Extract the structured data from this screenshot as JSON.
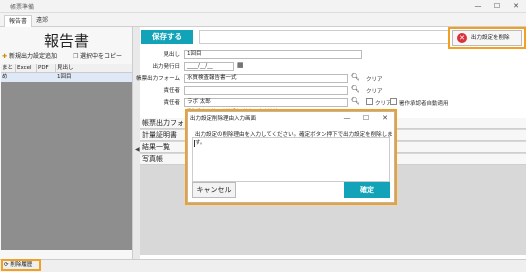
{
  "window": {
    "title": "帳票準備"
  },
  "tabs": [
    {
      "label": "報告書",
      "active": true
    },
    {
      "label": "遠郊",
      "active": false
    }
  ],
  "left": {
    "title": "報告書",
    "add_label": "新規出力設定追加",
    "copy_label": "選択中をコピー",
    "grid_headers": [
      "まとめ",
      "Excel",
      "PDF",
      "見出し"
    ],
    "grid_rows": [
      {
        "col4": "1回目"
      }
    ]
  },
  "toolbar": {
    "save_label": "保存する",
    "delete_label": "出力設定を削除",
    "delete_icon": "close-circle-icon"
  },
  "form": {
    "fields": [
      {
        "label": "見出し",
        "value": "1回目"
      },
      {
        "label": "出力発行日",
        "value": "____/__/__"
      },
      {
        "label": "帳票出力フォーム",
        "value": "水質検査報告書一式"
      },
      {
        "label": "責任者",
        "value": ""
      },
      {
        "label": "責任者",
        "value": "ラボ 太郎"
      }
    ],
    "clear_label": "クリア",
    "auto_apply_label": "署作承認者自動適用",
    "hidden_option_text": "報告設定を使用(試料別で輸え、出力連続)"
  },
  "sections": [
    "帳票出力フォ",
    "計量証明書",
    "結果一覧",
    "写真帳"
  ],
  "modal": {
    "title": "出力設定削除理由入力画面",
    "message": "出力設定の削除理由を入力してください。確定ボタン押下で出力設定を削除します。",
    "cancel_label": "キャンセル",
    "ok_label": "確定"
  },
  "footer": {
    "history_label": "削除履歴"
  },
  "colors": {
    "accent": "#12a3b8",
    "highlight": "#f2a024",
    "delete": "#d9323d"
  }
}
